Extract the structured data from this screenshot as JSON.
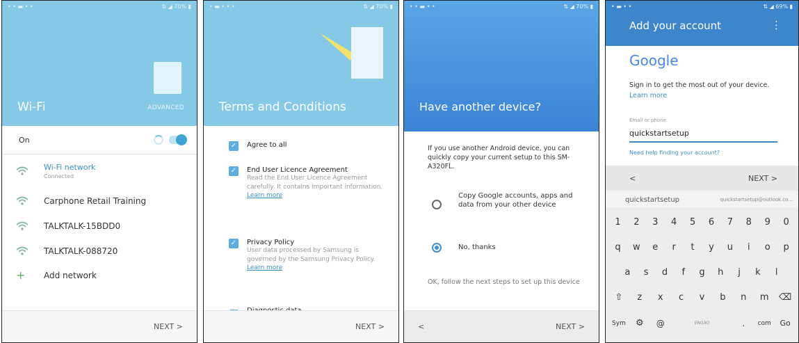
{
  "phones": [
    {
      "status": {
        "left": "• • ▬ • •",
        "right": "⇅ ◢ 70% ▮"
      },
      "title": "Wi-Fi",
      "advanced": "ADVANCED",
      "on_label": "On",
      "networks": [
        {
          "name": "Wi-Fi network",
          "status": "Connected",
          "icon": "wifi-icon"
        },
        {
          "name": "Carphone Retail Training",
          "icon": "wifi-icon"
        },
        {
          "name": "TALKTALK-15BDD0",
          "icon": "wifi-icon"
        },
        {
          "name": "TALKTALK-088720",
          "icon": "wifi-icon"
        }
      ],
      "add_network": "Add network",
      "next": "NEXT  >"
    },
    {
      "status": {
        "left": "• ▬ • • •",
        "right": "⇅ ◢ 70% ▮"
      },
      "title": "Terms and Conditions",
      "agree_all": "Agree to all",
      "items": [
        {
          "title": "End User Licence Agreement",
          "desc": "Read the End User Licence Agreement carefully. It contains important information.",
          "link": "Learn more"
        },
        {
          "title": "Privacy Policy",
          "desc": "User data processed by Samsung is governed by the Samsung Privacy Policy.",
          "link": "Learn more"
        }
      ],
      "partial": "Diagnostic data",
      "next": "NEXT  >"
    },
    {
      "status": {
        "left": "• • ▬ • •",
        "right": "⇅ ◢ 70% ▮"
      },
      "title": "Have another device?",
      "intro": "If you use another Android device, you can quickly copy your current setup to this SM-A320FL.",
      "option_copy": "Copy Google accounts, apps and data from your other device",
      "option_no": "No, thanks",
      "footer": "OK, follow the next steps to set up this device",
      "back": "<",
      "next": "NEXT  >"
    },
    {
      "status": {
        "left": "• ▬ • •",
        "right": "⇅ ◢ 69% ▮"
      },
      "title": "Add your account",
      "menu": "⋮",
      "google": "Google",
      "signin": "Sign in to get the most out of your device.",
      "learn_more": "Learn more",
      "email_label": "Email or phone",
      "email_value": "quickstartsetup",
      "help": "Need help finding your account?",
      "back": "<",
      "next": "NEXT  >",
      "suggestions": [
        "quickstartsetup",
        "quickstartsetup@outlook.co..."
      ],
      "keys": {
        "row1": [
          "1",
          "2",
          "3",
          "4",
          "5",
          "6",
          "7",
          "8",
          "9",
          "0"
        ],
        "row2": [
          "q",
          "w",
          "e",
          "r",
          "t",
          "y",
          "u",
          "i",
          "o",
          "p"
        ],
        "row3": [
          "a",
          "s",
          "d",
          "f",
          "g",
          "h",
          "j",
          "k",
          "l"
        ],
        "row4": [
          "⇧",
          "z",
          "x",
          "c",
          "v",
          "b",
          "n",
          "m",
          "⌫"
        ],
        "row5": [
          "Sym",
          "⚙",
          "@",
          "EN(UK)",
          ".",
          "com",
          "Go"
        ]
      }
    }
  ],
  "colors": {
    "hero": "#86c9e6",
    "blue": "#3e86cc",
    "accent": "#3ea4d2"
  }
}
